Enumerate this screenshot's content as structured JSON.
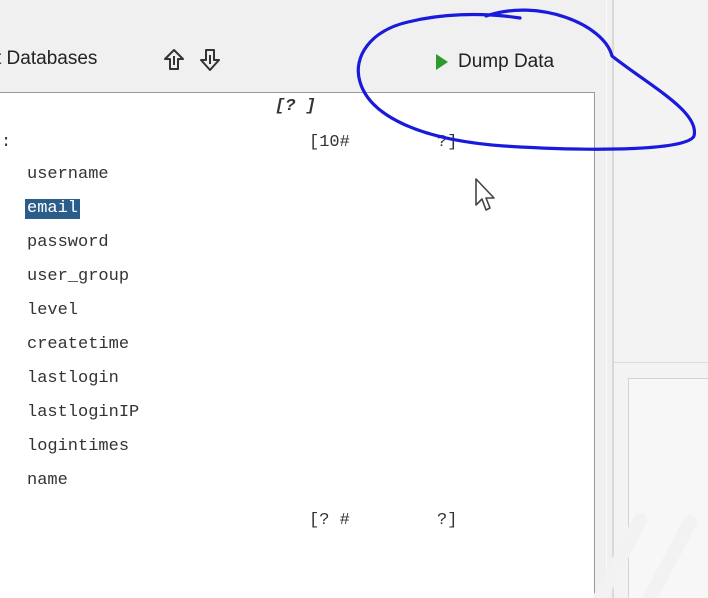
{
  "toolbar": {
    "databases_label": "t Databases",
    "dump_label": "Dump Data",
    "icons": [
      "move-up-icon",
      "move-down-icon",
      "play-icon"
    ]
  },
  "panel": {
    "header_marker": "[? ]",
    "table_marker": ":",
    "table_count_marker": "[10#",
    "table_count_end": "?]",
    "fields": [
      "username",
      "email",
      "password",
      "user_group",
      "level",
      "createtime",
      "lastlogin",
      "lastloginIP",
      "logintimes",
      "name"
    ],
    "selected_field": "email",
    "footer_marker_start": "[? #",
    "footer_marker_end": "?]"
  },
  "colors": {
    "selection": "#2b5d8a",
    "play": "#2e9a2e",
    "annotation": "#1a1adc"
  }
}
